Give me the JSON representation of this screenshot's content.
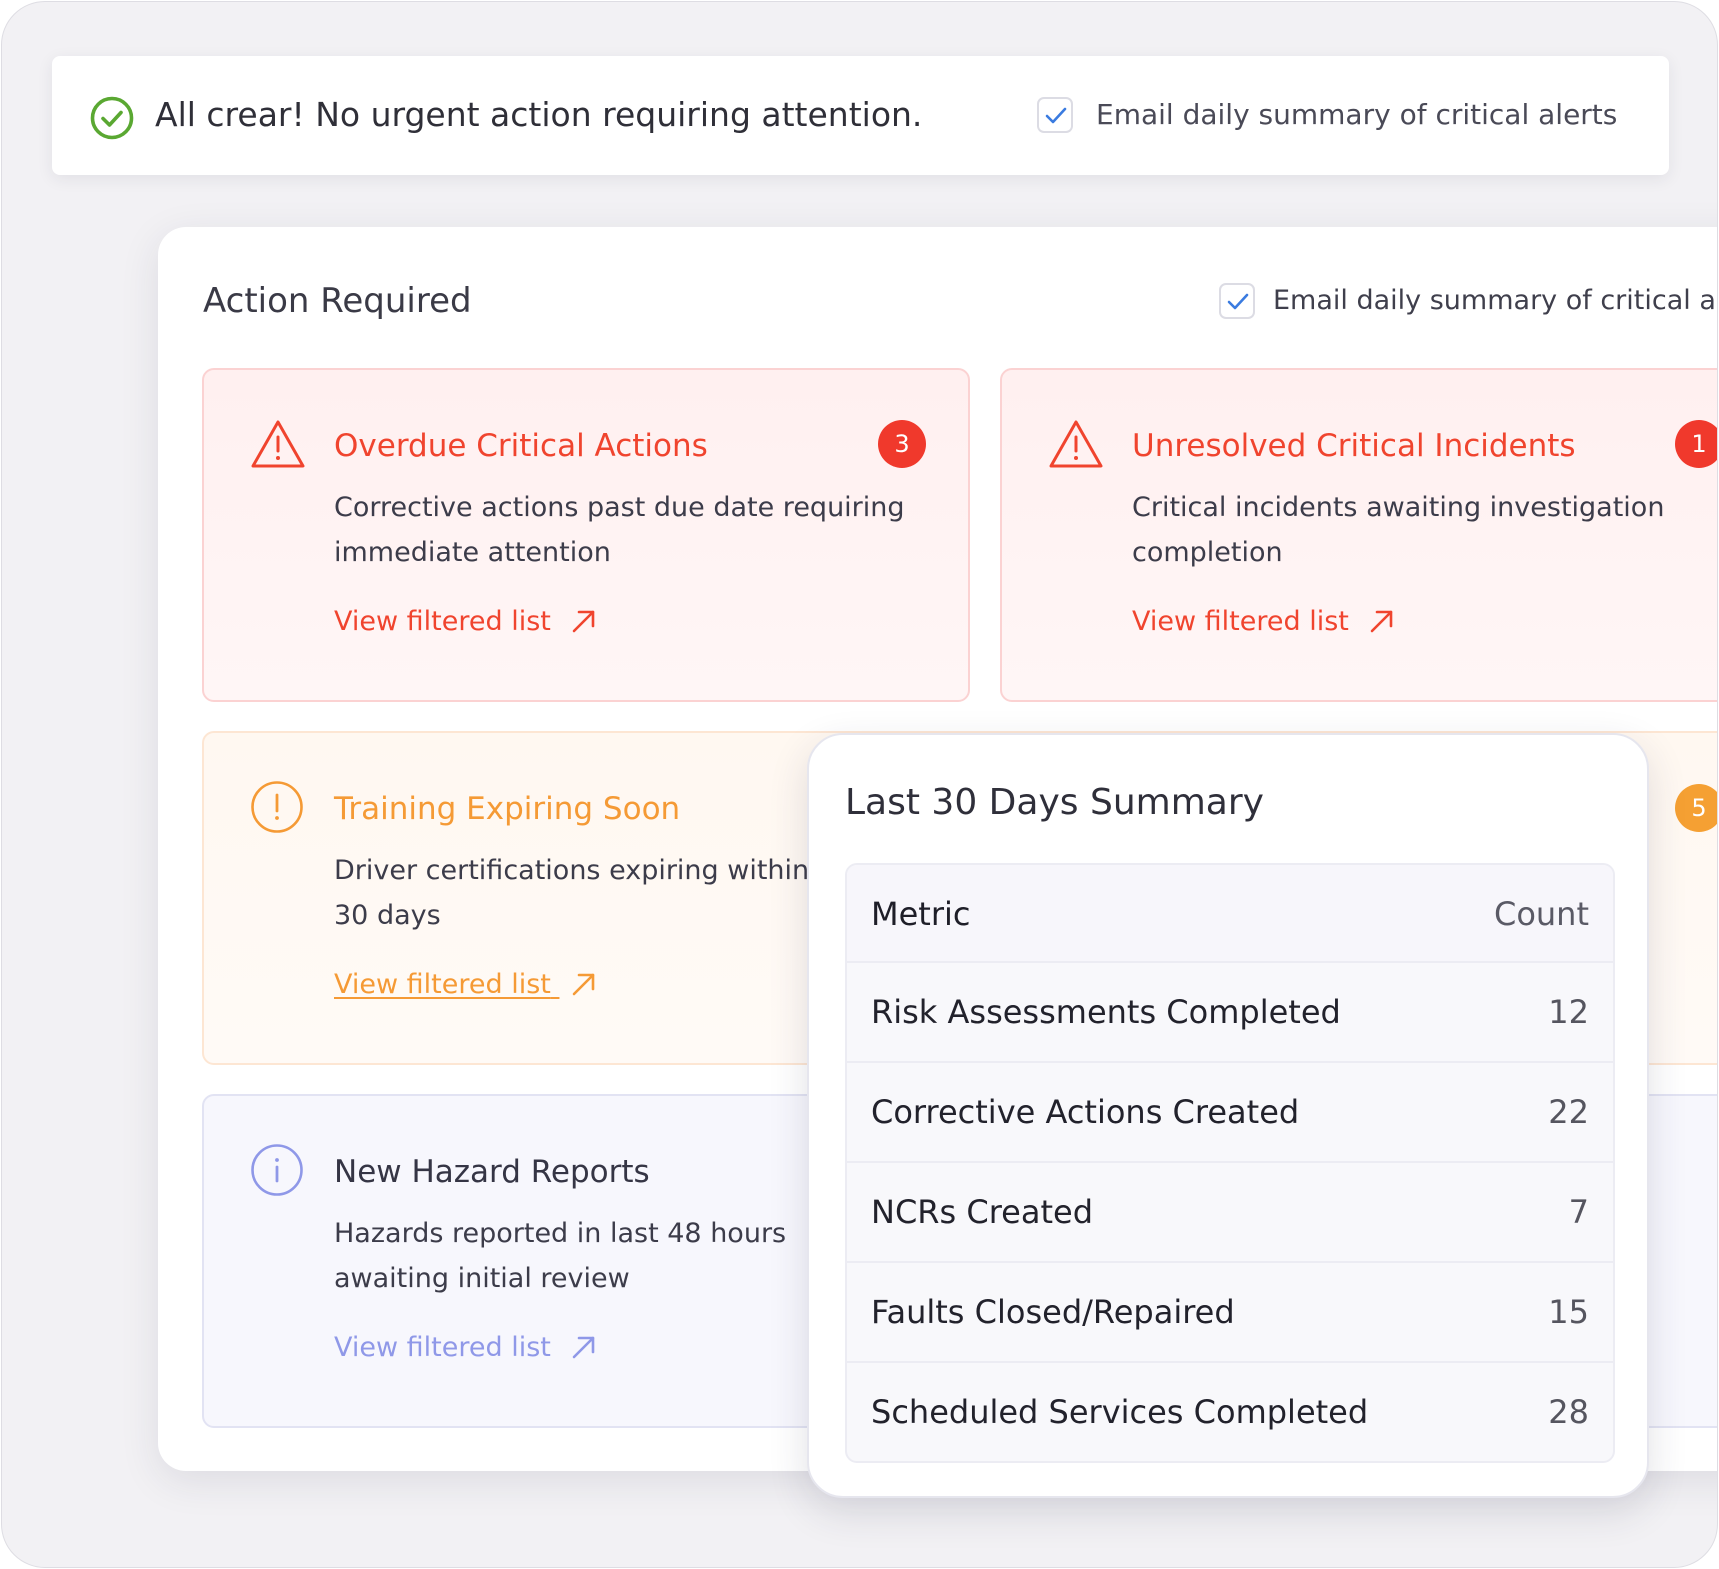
{
  "banner": {
    "message": "All crear! No urgent action requiring attention.",
    "email_label": "Email daily summary of critical alerts",
    "email_checked": true
  },
  "panel": {
    "title": "Action Required",
    "email_label": "Email daily summary of critical alerts",
    "email_checked": true
  },
  "cards": [
    {
      "title": "Overdue Critical Actions",
      "description": "Corrective actions past due date requiring immediate attention",
      "link": "View filtered list",
      "count": "3",
      "severity": "critical",
      "color": "#f0442e"
    },
    {
      "title": "Unresolved Critical Incidents",
      "description": "Critical incidents awaiting investigation completion",
      "link": "View filtered list",
      "count": "1",
      "severity": "critical",
      "color": "#f0442e"
    },
    {
      "title": "Training Expiring Soon",
      "description": "Driver certifications expiring within 30 days",
      "link": "View filtered list",
      "count": "5",
      "severity": "warning",
      "color": "#f59a35"
    },
    {
      "title": "New Hazard Reports",
      "description": "Hazards reported in last 48 hours awaiting initial review",
      "link": "View filtered list",
      "severity": "info",
      "color": "#8f98e8"
    }
  ],
  "summary": {
    "title": "Last 30 Days Summary",
    "columns": [
      "Metric",
      "Count"
    ],
    "rows": [
      {
        "metric": "Risk Assessments Completed",
        "count": "12"
      },
      {
        "metric": "Corrective Actions Created",
        "count": "22"
      },
      {
        "metric": "NCRs Created",
        "count": "7"
      },
      {
        "metric": "Faults Closed/Repaired",
        "count": "15"
      },
      {
        "metric": "Scheduled Services Completed",
        "count": "28"
      }
    ]
  },
  "icons": {
    "banner": "check-circle-icon",
    "critical": "warning-triangle-icon",
    "warning": "exclamation-circle-icon",
    "info": "info-circle-icon",
    "link": "arrow-up-right-icon"
  }
}
